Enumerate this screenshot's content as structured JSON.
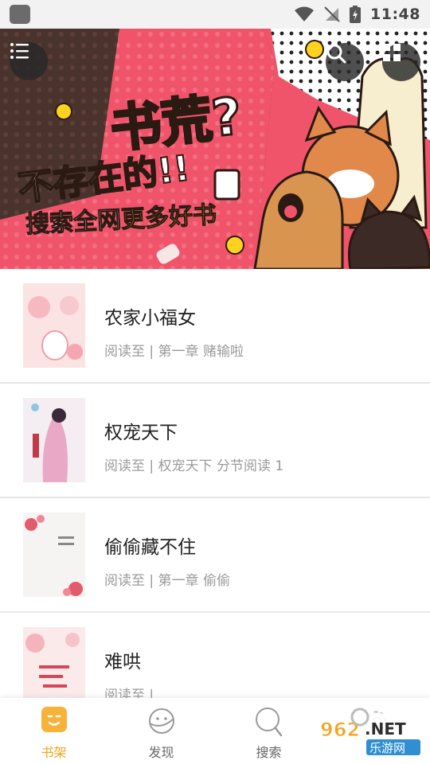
{
  "status_bar": {
    "time": "11:48"
  },
  "banner": {
    "line1": "书荒?",
    "line2": "不存在的!!",
    "line3_prefix": "搜索全网",
    "line3_highlight": "更多好书"
  },
  "books": [
    {
      "title": "农家小福女",
      "progress": "阅读至 | 第一章 赌输啦"
    },
    {
      "title": "权宠天下",
      "progress": "阅读至 | 权宠天下 分节阅读 1"
    },
    {
      "title": "偷偷藏不住",
      "progress": "阅读至 | 第一章 偷偷"
    },
    {
      "title": "难哄",
      "progress": "阅读至 |"
    }
  ],
  "nav": {
    "tabs": [
      {
        "label": "书架",
        "icon": "bookshelf-icon",
        "active": true
      },
      {
        "label": "发现",
        "icon": "planet-icon",
        "active": false
      },
      {
        "label": "搜索",
        "icon": "search-icon",
        "active": false
      },
      {
        "label": "",
        "icon": "settings-icon",
        "active": false
      }
    ],
    "watermark": "962.NET 乐游网"
  },
  "colors": {
    "accent": "#f5a31a",
    "banner_pink": "#f0546a",
    "banner_brown": "#4a332d"
  }
}
